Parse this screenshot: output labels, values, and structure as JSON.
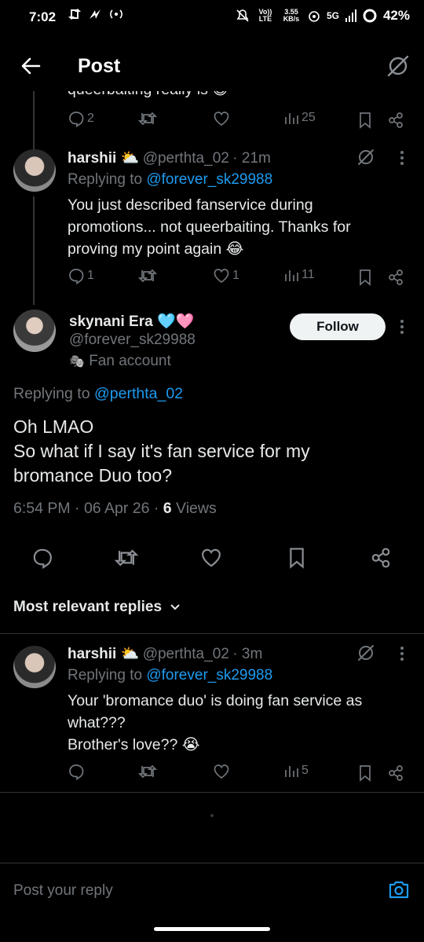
{
  "status_bar": {
    "time": "7:02",
    "volte": "Vo)) LTE",
    "speed_value": "3.55",
    "speed_unit": "KB/s",
    "network": "5G",
    "battery": "42%"
  },
  "header": {
    "title": "Post"
  },
  "prev_reply": {
    "partial_text": "queerbaiting really is 😅",
    "replies": "2",
    "views": "25"
  },
  "reply1": {
    "name": "harshii ⛅",
    "handle": "@perthta_02",
    "time": "· 21m",
    "replying_to_label": "Replying to",
    "replying_to_handle": "@forever_sk29988",
    "text": "You just described fanservice during promotions... not queerbaiting. Thanks for proving my point again 😂",
    "replies": "1",
    "likes": "1",
    "views": "11"
  },
  "main_post": {
    "name": "skynani Era 🩵🩷",
    "handle": "@forever_sk29988",
    "label_icon": "🎭",
    "label": "Fan account",
    "follow_label": "Follow",
    "replying_to_label": "Replying to",
    "replying_to_handle": "@perthta_02",
    "text_line1": "Oh LMAO",
    "text_line2": "So what if I say it's fan service for my bromance Duo too?",
    "timestamp": "6:54 PM · 06 Apr 26 · ",
    "views_count": "6",
    "views_label": " Views"
  },
  "sort": {
    "label": "Most relevant replies"
  },
  "reply2": {
    "name": "harshii ⛅",
    "handle": "@perthta_02",
    "time": "· 3m",
    "replying_to_label": "Replying to",
    "replying_to_handle": "@forever_sk29988",
    "text_line1": "Your 'bromance duo' is doing fan service as what???",
    "text_line2": "Brother's love?? 😭",
    "views": "5"
  },
  "reply_bar": {
    "placeholder": "Post your reply"
  },
  "colors": {
    "background": "#000000",
    "text": "#e7e9ea",
    "muted": "#71767b",
    "link": "#1d9bf0",
    "divider": "#2f3336"
  }
}
